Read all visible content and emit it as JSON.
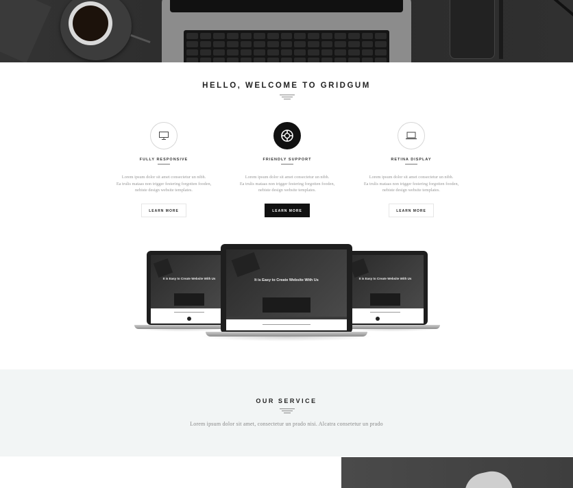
{
  "welcome": {
    "title": "HELLO, WELCOME TO GRIDGUM"
  },
  "features": [
    {
      "name": "FULLY RESPONSIVE",
      "icon": "monitor-icon",
      "lines": [
        "Lorem ipsum dolor sit amet consectetur un nibh.",
        "Ea trulis mataas non trigger festering forgotten fooden,",
        "nebiste design website templates."
      ],
      "button": "LEARN MORE",
      "active": false
    },
    {
      "name": "FRIENDLY SUPPORT",
      "icon": "lifebuoy-icon",
      "lines": [
        "Lorem ipsum dolor sit amet consectetur un nibh.",
        "Ea trulis mataas non trigger festering forgotten fooden,",
        "nebiste design website templates."
      ],
      "button": "LEARN MORE",
      "active": true
    },
    {
      "name": "RETINA DISPLAY",
      "icon": "laptop-icon",
      "lines": [
        "Lorem ipsum dolor sit amet consectetur un nibh.",
        "Ea trulis mataas non trigger festering forgotten fooden,",
        "nebiste design website templates."
      ],
      "button": "LEARN MORE",
      "active": false
    }
  ],
  "devices": {
    "headline": "It is Easy to Create Website With Us"
  },
  "service": {
    "title": "OUR SERVICE",
    "subtitle": "Lorem ipsum dolor sit amet, consectetur un prado nisi. Alcatra consetetur un prado"
  },
  "colors": {
    "dark": "#111111",
    "section_bg": "#f2f5f5",
    "muted_text": "#999999"
  }
}
